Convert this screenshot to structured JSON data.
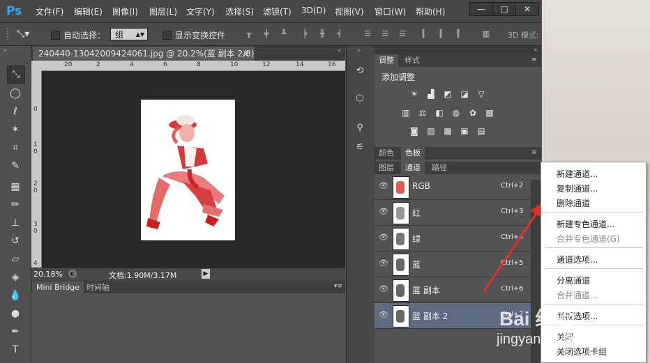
{
  "app": {
    "logo": "Ps"
  },
  "menubar": {
    "items": [
      "文件(F)",
      "编辑(E)",
      "图像(I)",
      "图层(L)",
      "文字(Y)",
      "选择(S)",
      "滤镜(T)",
      "3D(D)",
      "视图(V)",
      "窗口(W)",
      "帮助(H)"
    ],
    "min": "—",
    "max": "□",
    "close": "✕"
  },
  "options": {
    "auto_select_label": "自动选择：",
    "auto_select_value": "组",
    "show_transform_label": "显示变换控件",
    "mode_3d_label": "3D 模式:"
  },
  "document": {
    "tab_title": "240440-13042009424061.jpg @ 20.2%(蓝 副本 2/8) *",
    "tab_close": "×",
    "ruler_h": [
      "20",
      "2",
      "4",
      "6",
      "8",
      "10",
      "12",
      "14",
      "16",
      "18"
    ],
    "ruler_v": [
      "0",
      "1\n0",
      "2\n0",
      "3\n0",
      "4"
    ],
    "zoom": "20.18%",
    "doc_info": "文档:1.90M/3.17M"
  },
  "bottom_panel": {
    "tabs": [
      "Mini Bridge",
      "时间轴"
    ]
  },
  "adjustments": {
    "tabs": [
      "调整",
      "样式"
    ],
    "title": "添加调整"
  },
  "color_panel": {
    "tabs": [
      "颜色",
      "色板"
    ]
  },
  "channels_panel": {
    "tabs": [
      "图层",
      "通道",
      "路径"
    ],
    "channels": [
      {
        "name": "RGB",
        "shortcut": "Ctrl+2"
      },
      {
        "name": "红",
        "shortcut": "Ctrl+3"
      },
      {
        "name": "绿",
        "shortcut": "Ctrl+4"
      },
      {
        "name": "蓝",
        "shortcut": "Ctrl+5"
      },
      {
        "name": "蓝 副本",
        "shortcut": "Ctrl+6"
      },
      {
        "name": "蓝 副本 2",
        "shortcut": "Ctrl+7"
      }
    ]
  },
  "context_menu": {
    "items": [
      {
        "label": "新建通道...",
        "enabled": true
      },
      {
        "label": "复制通道...",
        "enabled": true
      },
      {
        "label": "删除通道",
        "enabled": true
      },
      {
        "label": "新建专色通道...",
        "enabled": true
      },
      {
        "label": "合并专色通道(G)",
        "enabled": false
      },
      {
        "label": "通道选项...",
        "enabled": true
      },
      {
        "label": "分离通道",
        "enabled": true
      },
      {
        "label": "合并通道...",
        "enabled": false
      },
      {
        "label": "面板选项...",
        "enabled": true
      },
      {
        "label": "关闭",
        "enabled": true
      },
      {
        "label": "关闭选项卡组",
        "enabled": true
      }
    ]
  },
  "watermark": {
    "line1": "Bai 经验",
    "line2": "jingyan.baidu.com"
  },
  "colors": {
    "accent_arrow": "#e0302a",
    "selected_row": "#5e6b80",
    "logo": "#31a8ff"
  }
}
